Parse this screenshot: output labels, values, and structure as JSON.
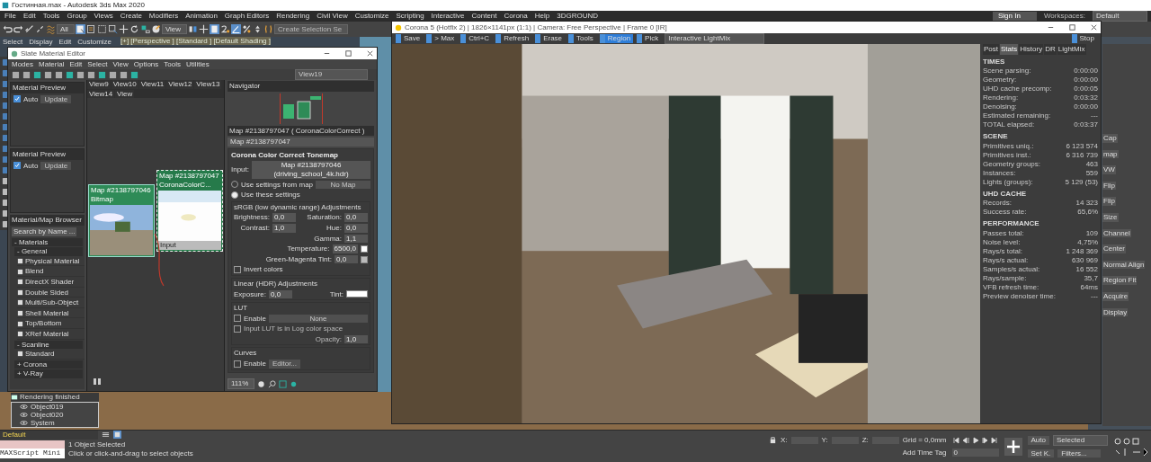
{
  "title": "Гостинная.max - Autodesk 3ds Max 2020",
  "menu": [
    "File",
    "Edit",
    "Tools",
    "Group",
    "Views",
    "Create",
    "Modifiers",
    "Animation",
    "Graph Editors",
    "Rendering",
    "Civil View",
    "Customize",
    "Scripting",
    "Interactive",
    "Content",
    "Corona",
    "Help",
    "3DGROUND"
  ],
  "account": {
    "sign_in": "Sign In",
    "workspaces_label": "Workspaces:",
    "workspace": "Default"
  },
  "toolbar": {
    "filter": "All",
    "coord": "View",
    "selection_set": "Create Selection Se"
  },
  "command_tabs": [
    "Select",
    "Display",
    "Edit",
    "Customize"
  ],
  "viewport_label": "[+] [Perspective ] [Standard ] [Default Shading ]",
  "material_editor": {
    "title": "Slate Material Editor",
    "menu": [
      "Modes",
      "Material",
      "Edit",
      "Select",
      "View",
      "Options",
      "Tools",
      "Utilities"
    ],
    "view_dropdown": "View19",
    "view_tabs": [
      {
        "label": "View9",
        "selected": false
      },
      {
        "label": "View10",
        "selected": false
      },
      {
        "label": "View11",
        "selected": false
      },
      {
        "label": "View12",
        "selected": false
      },
      {
        "label": "View13",
        "selected": false
      },
      {
        "label": "View14",
        "selected": false
      },
      {
        "label": "View",
        "selected": false
      }
    ],
    "previews": [
      {
        "title": "Material Preview",
        "auto": "Auto",
        "checked": true,
        "update": "Update"
      },
      {
        "title": "Material Preview",
        "auto": "Auto",
        "checked": true,
        "update": "Update"
      }
    ],
    "navigator": "Navigator",
    "nodes": [
      {
        "title": "Map #2138797046",
        "subtitle": "Bitmap",
        "selected": false
      },
      {
        "title": "Map #2138797047",
        "subtitle": "CoronaColorC...",
        "selected": true,
        "port": "Input"
      }
    ],
    "params": {
      "header": "Map #2138797047  ( CoronaColorCorrect )",
      "name": "Map #2138797047",
      "rollout": "Corona Color Correct Tonemap",
      "input_label": "Input:",
      "input_map": "Map #2138797046 (driving_school_4k.hdr)",
      "modes": [
        {
          "label": "Use settings from map",
          "selected": false
        },
        {
          "label": "Use these settings",
          "selected": true
        }
      ],
      "no_map": "No Map",
      "srgb_title": "sRGB (low dynamic range) Adjustments",
      "srgb_left": [
        {
          "label": "Brightness:",
          "value": "0,0"
        },
        {
          "label": "Contrast:",
          "value": "1,0"
        }
      ],
      "srgb_right": [
        {
          "label": "Saturation:",
          "value": "0,0"
        },
        {
          "label": "Hue:",
          "value": "0,0"
        },
        {
          "label": "Gamma:",
          "value": "1,1"
        }
      ],
      "temperature": {
        "label": "Temperature:",
        "value": "6500,0"
      },
      "tint_gm": {
        "label": "Green-Magenta Tint:",
        "value": "0,0"
      },
      "invert": {
        "label": "Invert colors",
        "checked": false
      },
      "linear_title": "Linear (HDR) Adjustments",
      "exposure": {
        "label": "Exposure:",
        "value": "0,0"
      },
      "tint_label": "Tint:",
      "lut_title": "LUT",
      "lut_enable": {
        "label": "Enable",
        "checked": false
      },
      "lut_none": "None",
      "lut_log": {
        "label": "Input LUT is in Log color space",
        "checked": false
      },
      "opacity": {
        "label": "Opacity:",
        "value": "1,0"
      },
      "curves_title": "Curves",
      "curves_enable": {
        "label": "Enable",
        "checked": false
      },
      "curves_editor": "Editor..."
    },
    "browser": {
      "title": "Material/Map Browser",
      "placeholder": "Search by Name ...",
      "tree": [
        {
          "label": "- Materials",
          "children": [
            {
              "label": "- General",
              "children": [
                {
                  "label": "Physical Material"
                },
                {
                  "label": "Blend"
                },
                {
                  "label": "DirectX Shader"
                },
                {
                  "label": "Double Sided"
                },
                {
                  "label": "Multi/Sub-Object"
                },
                {
                  "label": "Shell Material"
                },
                {
                  "label": "Top/Bottom"
                },
                {
                  "label": "XRef Material"
                }
              ]
            },
            {
              "label": "- Scanline",
              "children": [
                {
                  "label": "Standard"
                }
              ]
            },
            {
              "label": "+ Corona"
            },
            {
              "label": "+ V-Ray"
            }
          ]
        }
      ]
    },
    "zoom": "111%",
    "status": "Rendering finished"
  },
  "scene_explorer": [
    "Object019",
    "Object020",
    "System"
  ],
  "render_window": {
    "title": "Corona 5 (Hotfix 2) | 1826×1141px (1:1) | Camera: Free Perspective | Frame 0 [IR]",
    "tools": [
      {
        "label": "Save",
        "selected": false
      },
      {
        "label": "> Max",
        "selected": false
      },
      {
        "label": "Ctrl+C",
        "selected": false
      },
      {
        "label": "Refresh",
        "selected": false
      },
      {
        "label": "Erase",
        "selected": false
      },
      {
        "label": "Tools",
        "selected": false
      },
      {
        "label": "Region",
        "selected": true
      },
      {
        "label": "Pick",
        "selected": false
      }
    ],
    "lightmix": "Interactive LightMix",
    "stop": "Stop",
    "tabs": [
      {
        "label": "Post",
        "selected": false
      },
      {
        "label": "Stats",
        "selected": true
      },
      {
        "label": "History",
        "selected": false
      },
      {
        "label": "DR",
        "selected": false
      },
      {
        "label": "LightMix",
        "selected": false
      }
    ],
    "stats": [
      {
        "title": "TIMES",
        "rows": [
          {
            "label": "Scene parsing:",
            "value": "0:00:00"
          },
          {
            "label": "Geometry:",
            "value": "0:00:00"
          },
          {
            "label": "UHD cache precomp:",
            "value": "0:00:05"
          },
          {
            "label": "Rendering:",
            "value": "0:03:32"
          },
          {
            "label": "Denoising:",
            "value": "0:00:00"
          },
          {
            "label": "Estimated remaining:",
            "value": "---"
          },
          {
            "label": "TOTAL elapsed:",
            "value": "0:03:37"
          }
        ]
      },
      {
        "title": "SCENE",
        "rows": [
          {
            "label": "Primitives uniq.:",
            "value": "6 123 574"
          },
          {
            "label": "Primitives inst.:",
            "value": "6 316 739"
          },
          {
            "label": "Geometry groups:",
            "value": "463"
          },
          {
            "label": "Instances:",
            "value": "559"
          },
          {
            "label": "Lights (groups):",
            "value": "5 129 (53)"
          }
        ]
      },
      {
        "title": "UHD CACHE",
        "rows": [
          {
            "label": "Records:",
            "value": "14 323"
          },
          {
            "label": "Success rate:",
            "value": "65,6%"
          }
        ]
      },
      {
        "title": "PERFORMANCE",
        "rows": [
          {
            "label": "Passes total:",
            "value": "109"
          },
          {
            "label": "Noise level:",
            "value": "4,75%"
          },
          {
            "label": "Rays/s total:",
            "value": "1 248 369"
          },
          {
            "label": "Rays/s actual:",
            "value": "630 969"
          },
          {
            "label": "Samples/s actual:",
            "value": "16 552"
          },
          {
            "label": "Rays/sample:",
            "value": "35,7"
          },
          {
            "label": "VFB refresh time:",
            "value": "64ms"
          },
          {
            "label": "Preview denoiser time:",
            "value": "---"
          }
        ]
      }
    ]
  },
  "command_panel": [
    "Cap",
    "map",
    "VW",
    "Flip",
    "Flip",
    "Size",
    "Channel",
    "Center",
    "Normal Align",
    "Region Fit",
    "Acquire",
    "Display"
  ],
  "status_bar": {
    "layer": "Default",
    "maxscript": "MAXScript Mini",
    "selected": "1 Object Selected",
    "prompt": "Click or click-and-drag to select objects",
    "x": "X:",
    "y": "Y:",
    "z": "Z:",
    "grid": "Grid = 0,0mm",
    "time_tag": "Add Time Tag",
    "frame": "0",
    "auto": "Auto",
    "key_mode": "Selected",
    "set_key": "Set K.",
    "filters": "Filters..."
  }
}
